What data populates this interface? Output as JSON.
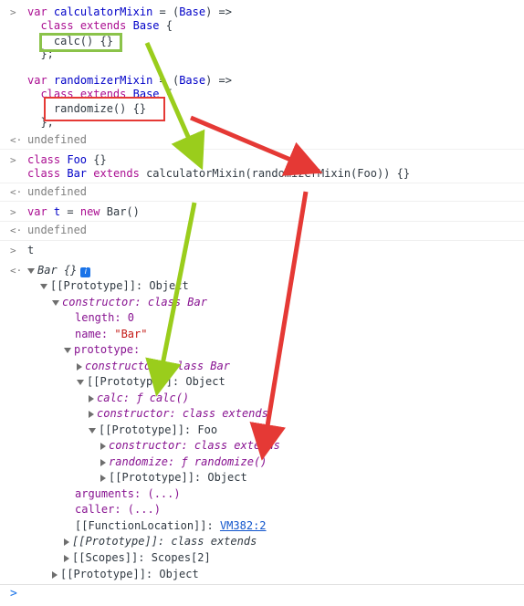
{
  "entries": [
    {
      "lines": [
        "var calculatorMixin = (Base) =>",
        "  class extends Base {",
        "    calc() {}",
        "  };"
      ]
    },
    {
      "lines": [
        "var randomizerMixin = (Base) =>",
        "  class extends Base {",
        "    randomize() {}",
        "  };"
      ]
    },
    {
      "result": "undefined"
    },
    {
      "lines": [
        "class Foo {}",
        "class Bar extends calculatorMixin(randomizerMixin(Foo)) {}"
      ]
    },
    {
      "result": "undefined"
    },
    {
      "lines": [
        "var t = new Bar()"
      ]
    },
    {
      "result": "undefined"
    },
    {
      "lines": [
        "t"
      ]
    }
  ],
  "tree": {
    "root": "Bar {}",
    "info_icon": "i",
    "proto1": "[[Prototype]]: Object",
    "constructor": "constructor: class Bar",
    "length": "length: 0",
    "name_key": "name: ",
    "name_val": "\"Bar\"",
    "prototype": "prototype:",
    "p_constructor": "constructor: class Bar",
    "p_proto": "[[Prototype]]: Object",
    "calc": "calc: ƒ calc()",
    "c_constructor": "constructor: class extends",
    "c_proto": "[[Prototype]]: Foo",
    "r_constructor": "constructor: class extends",
    "randomize": "randomize: ƒ randomize()",
    "r_proto": "[[Prototype]]: Object",
    "arguments": "arguments: (...)",
    "caller": "caller: (...)",
    "function_location_key": "[[FunctionLocation]]: ",
    "function_location_link": "VM382:2",
    "fn_proto": "[[Prototype]]: class extends",
    "scopes": "[[Scopes]]: Scopes[2]",
    "root_proto": "[[Prototype]]: Object"
  },
  "prompt_symbol": ">",
  "result_symbol": "<·"
}
